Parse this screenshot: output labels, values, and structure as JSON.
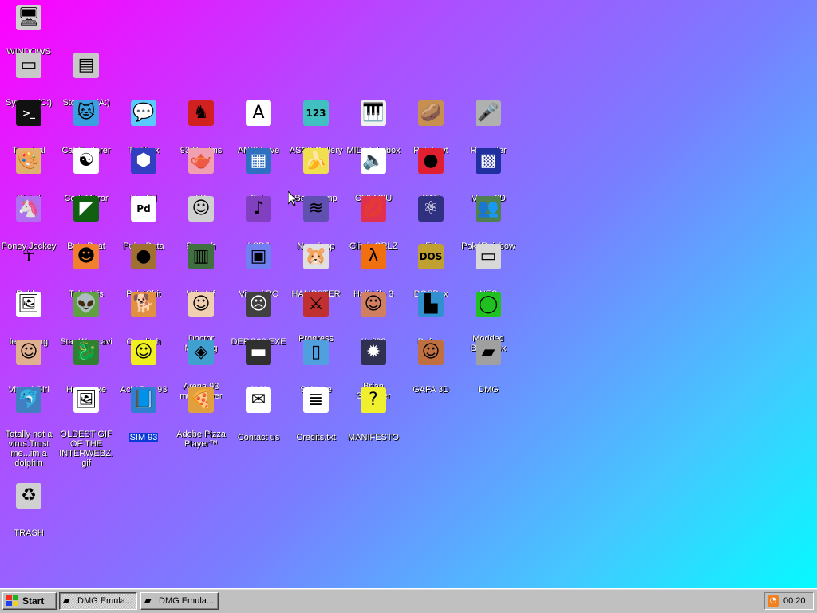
{
  "desktop": {
    "icons": [
      {
        "label": "WINDOWS 93",
        "icon": "computer-icon",
        "glyph": "🖥",
        "bg": "#d0d0d0",
        "col": 0,
        "row": 0
      },
      {
        "label": "System (C:)",
        "icon": "hard-drive-icon",
        "glyph": "▭",
        "bg": "#c8c8c8",
        "col": 0,
        "row": 1
      },
      {
        "label": "Storage (A:)",
        "icon": "floppy-drive-icon",
        "glyph": "▤",
        "bg": "#c8c8c8",
        "col": 1,
        "row": 1
      },
      {
        "label": "Terminal",
        "icon": "terminal-icon",
        "glyph": ">_",
        "bg": "#111111",
        "col": 0,
        "row": 2
      },
      {
        "label": "Cat Explorer",
        "icon": "cat-globe-icon",
        "glyph": "🐱",
        "bg": "#3aa0e0",
        "col": 1,
        "row": 2
      },
      {
        "label": "Trollbox",
        "icon": "chat-bubble-icon",
        "glyph": "💬",
        "bg": "#59c9ff",
        "col": 2,
        "row": 2
      },
      {
        "label": "93 Realms",
        "icon": "knight-icon",
        "glyph": "♞",
        "bg": "#d02020",
        "col": 3,
        "row": 2
      },
      {
        "label": "ANSI Love",
        "icon": "ansi-letter-icon",
        "glyph": "A",
        "bg": "#ffffff",
        "col": 4,
        "row": 2
      },
      {
        "label": "ASCII Gallery",
        "icon": "numbers-icon",
        "glyph": "123",
        "bg": "#40c0c0",
        "col": 5,
        "row": 2
      },
      {
        "label": "MIDI Jukebox",
        "icon": "piano-keys-icon",
        "glyph": "🎹",
        "bg": "#f0f0f0",
        "col": 6,
        "row": 2
      },
      {
        "label": "Potato.yt",
        "icon": "potato-icon",
        "glyph": "🥔",
        "bg": "#c89050",
        "col": 7,
        "row": 2
      },
      {
        "label": "Recorder",
        "icon": "microphone-icon",
        "glyph": "🎤",
        "bg": "#b0b0b0",
        "col": 8,
        "row": 2
      },
      {
        "label": "Piskel",
        "icon": "palette-icon",
        "glyph": "🎨",
        "bg": "#e0b070",
        "col": 0,
        "row": 3
      },
      {
        "label": "CodeMirror",
        "icon": "codemirror-icon",
        "glyph": "☯",
        "bg": "#ffffff",
        "col": 1,
        "row": 3
      },
      {
        "label": "HexEd",
        "icon": "hex-cube-icon",
        "glyph": "⬢",
        "bg": "#3040c0",
        "col": 2,
        "row": 3
      },
      {
        "label": "3D",
        "icon": "teapot-icon",
        "glyph": "🫖",
        "bg": "#f0a0b0",
        "col": 3,
        "row": 3
      },
      {
        "label": "Calc",
        "icon": "calculator-icon",
        "glyph": "▦",
        "bg": "#3070c0",
        "col": 4,
        "row": 3
      },
      {
        "label": "Bananamp",
        "icon": "banana-icon",
        "glyph": "🍌",
        "bg": "#f0e050",
        "col": 5,
        "row": 3
      },
      {
        "label": "C80.M3U",
        "icon": "audio-file-icon",
        "glyph": "🔈",
        "bg": "#ffffff",
        "col": 6,
        "row": 3
      },
      {
        "label": "SAE",
        "icon": "checkered-ball-icon",
        "glyph": "●",
        "bg": "#e02030",
        "col": 7,
        "row": 3
      },
      {
        "label": "Maze 3D",
        "icon": "maze-icon",
        "glyph": "▩",
        "bg": "#2030a0",
        "col": 8,
        "row": 3
      },
      {
        "label": "Poney Jockey",
        "icon": "pony-icon",
        "glyph": "🦄",
        "bg": "#b070f0",
        "col": 0,
        "row": 4
      },
      {
        "label": "Byte Beat",
        "icon": "waveform-icon",
        "glyph": "◤",
        "bg": "#106010",
        "col": 1,
        "row": 4
      },
      {
        "label": "Puke Data",
        "icon": "pd-icon",
        "glyph": "Pd",
        "bg": "#ffffff",
        "col": 2,
        "row": 4
      },
      {
        "label": "Speech",
        "icon": "face-icon",
        "glyph": "☺",
        "bg": "#d0d0d0",
        "col": 3,
        "row": 4
      },
      {
        "label": "LSDJ",
        "icon": "lsdj-icon",
        "glyph": "♪",
        "bg": "#8040c0",
        "col": 4,
        "row": 4
      },
      {
        "label": "Nanoloop",
        "icon": "nanoloop-icon",
        "glyph": "≋",
        "bg": "#6050b0",
        "col": 5,
        "row": 4
      },
      {
        "label": "Glitch GRLZ",
        "icon": "lips-icon",
        "glyph": "💋",
        "bg": "#e03050",
        "col": 6,
        "row": 4
      },
      {
        "label": "FX",
        "icon": "atom-icon",
        "glyph": "⚛",
        "bg": "#303080",
        "col": 7,
        "row": 4
      },
      {
        "label": "PokéRainbow",
        "icon": "trainers-icon",
        "glyph": "👥",
        "bg": "#508050",
        "col": 8,
        "row": 4
      },
      {
        "label": "Robby",
        "icon": "stick-figure-icon",
        "glyph": "☥",
        "bg": "transparent",
        "col": 0,
        "row": 5
      },
      {
        "label": "Take this",
        "icon": "pixel-character-icon",
        "glyph": "☻",
        "bg": "#f08030",
        "col": 1,
        "row": 5
      },
      {
        "label": "PokéShit",
        "icon": "brown-blob-icon",
        "glyph": "●",
        "bg": "#a07030",
        "col": 2,
        "row": 5
      },
      {
        "label": "What If",
        "icon": "barcode-icon",
        "glyph": "▥",
        "bg": "#407040",
        "col": 3,
        "row": 5
      },
      {
        "label": "Virtual PC",
        "icon": "window-icon",
        "glyph": "▣",
        "bg": "#7080f0",
        "col": 4,
        "row": 5
      },
      {
        "label": "HAMPSTER",
        "icon": "hamster-icon",
        "glyph": "🐹",
        "bg": "#e0e0e0",
        "col": 5,
        "row": 5
      },
      {
        "label": "Half-Life 3",
        "icon": "lambda-icon",
        "glyph": "λ",
        "bg": "#f07010",
        "col": 6,
        "row": 5
      },
      {
        "label": "DOSBox",
        "icon": "dosbox-icon",
        "glyph": "DOS",
        "bg": "#c0a030",
        "col": 7,
        "row": 5
      },
      {
        "label": "NES",
        "icon": "nes-console-icon",
        "glyph": "▭",
        "bg": "#d8d8d8",
        "col": 8,
        "row": 5
      },
      {
        "label": "lenna.png",
        "icon": "image-file-icon",
        "glyph": "🖼",
        "bg": "#ffffff",
        "col": 0,
        "row": 6
      },
      {
        "label": "Star Wars.avi",
        "icon": "yoda-icon",
        "glyph": "👽",
        "bg": "#60a040",
        "col": 1,
        "row": 6
      },
      {
        "label": "Corglitch",
        "icon": "corgi-icon",
        "glyph": "🐕",
        "bg": "#e09040",
        "col": 2,
        "row": 6
      },
      {
        "label": "Doctor Marburg",
        "icon": "doctor-icon",
        "glyph": "☺",
        "bg": "#f0d0b0",
        "col": 3,
        "row": 6
      },
      {
        "label": "DERG32.EXE",
        "icon": "monitor-face-icon",
        "glyph": "☹",
        "bg": "#404040",
        "col": 4,
        "row": 6
      },
      {
        "label": "Progress Quest",
        "icon": "crossed-swords-icon",
        "glyph": "⚔",
        "bg": "#c03030",
        "col": 5,
        "row": 6
      },
      {
        "label": "Kof'93",
        "icon": "fighter-portrait-icon",
        "glyph": "☺",
        "bg": "#d08060",
        "col": 6,
        "row": 6
      },
      {
        "label": "Defrag",
        "icon": "defrag-icon",
        "glyph": "▙",
        "bg": "#3090d0",
        "col": 7,
        "row": 6
      },
      {
        "label": "Modded BeepBox",
        "icon": "green-ring-icon",
        "glyph": "◯",
        "bg": "#20c020",
        "col": 8,
        "row": 6
      },
      {
        "label": "Virtual Girl",
        "icon": "girl-portrait-icon",
        "glyph": "☺",
        "bg": "#e0b090",
        "col": 0,
        "row": 7
      },
      {
        "label": "Hydra.exe",
        "icon": "dragon-icon",
        "glyph": "🐉",
        "bg": "#308030",
        "col": 1,
        "row": 7
      },
      {
        "label": "Acid Box 93",
        "icon": "smiley-icon",
        "glyph": "☺",
        "bg": "#f0f020",
        "col": 2,
        "row": 7
      },
      {
        "label": "Arena 93 multiplayer",
        "icon": "cube-icon",
        "glyph": "◈",
        "bg": "#40a0d0",
        "col": 3,
        "row": 7
      },
      {
        "label": "SMS",
        "icon": "sega-console-icon",
        "glyph": "▬",
        "bg": "#303030",
        "col": 4,
        "row": 7
      },
      {
        "label": "Solitude",
        "icon": "phone-icon",
        "glyph": "▯",
        "bg": "#50a0e0",
        "col": 5,
        "row": 7
      },
      {
        "label": "Brian Sweeper",
        "icon": "mine-icon",
        "glyph": "✹",
        "bg": "#303050",
        "col": 6,
        "row": 7
      },
      {
        "label": "GAFA 3D",
        "icon": "doom-face-icon",
        "glyph": "☺",
        "bg": "#c07040",
        "col": 7,
        "row": 7
      },
      {
        "label": "DMG",
        "icon": "gameboy-cartridge-icon",
        "glyph": "▰",
        "bg": "#a0a0a0",
        "col": 8,
        "row": 7
      },
      {
        "label": "Totally not a virus.Trust me...im a dolphin",
        "icon": "dolphin-icon",
        "glyph": "🐬",
        "bg": "#4080c0",
        "col": 0,
        "row": 8
      },
      {
        "label": "OLDEST GIF OF THE INTERWEBZ.gif",
        "icon": "gif-file-icon",
        "glyph": "🖼",
        "bg": "#ffffff",
        "col": 1,
        "row": 8
      },
      {
        "label": "SIM 93",
        "icon": "book-icon",
        "glyph": "📘",
        "bg": "#3080d0",
        "col": 2,
        "row": 8,
        "selected": true
      },
      {
        "label": "Adobe Pizza Player™",
        "icon": "pizza-icon",
        "glyph": "🍕",
        "bg": "#e0a040",
        "col": 3,
        "row": 8
      },
      {
        "label": "Contact us",
        "icon": "letter-pen-icon",
        "glyph": "✉",
        "bg": "#ffffff",
        "col": 4,
        "row": 8
      },
      {
        "label": "Credits.txt",
        "icon": "text-file-icon",
        "glyph": "≣",
        "bg": "#ffffff",
        "col": 5,
        "row": 8
      },
      {
        "label": "MANIFESTO",
        "icon": "question-mark-icon",
        "glyph": "?",
        "bg": "#f0f030",
        "col": 6,
        "row": 8
      },
      {
        "label": "TRASH",
        "icon": "recycle-bin-icon",
        "glyph": "♻",
        "bg": "#d0d0d0",
        "col": 0,
        "row": 10
      }
    ]
  },
  "taskbar": {
    "start_label": "Start",
    "tasks": [
      {
        "label": "DMG Emula...",
        "pressed": true
      },
      {
        "label": "DMG Emula...",
        "pressed": false
      }
    ],
    "clock": "00:20",
    "tray_icon": "rss-icon"
  }
}
